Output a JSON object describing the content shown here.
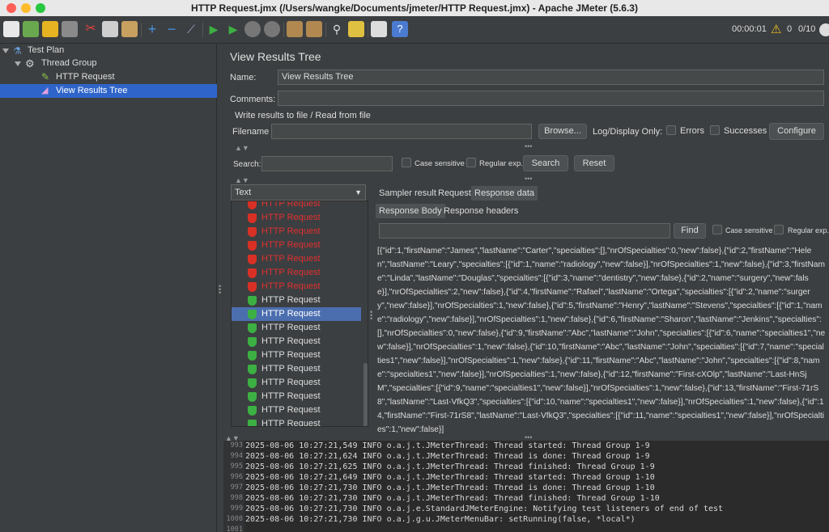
{
  "window": {
    "title": "HTTP Request.jmx (/Users/wangke/Documents/jmeter/HTTP Request.jmx) - Apache JMeter (5.6.3)"
  },
  "toolbar": {
    "timer": "00:00:01",
    "warning_count": "0",
    "thread_counter": "0/10",
    "icons": [
      "new-icon",
      "templates-icon",
      "open-icon",
      "save-icon",
      "cut-icon",
      "copy-icon",
      "paste-icon",
      "expand-icon",
      "collapse-icon",
      "toggle-icon",
      "start-icon",
      "start-no-pauses-icon",
      "stop-icon",
      "shutdown-icon",
      "clear-icon",
      "clear-all-icon",
      "search-icon",
      "reset-search-icon",
      "function-helper-icon",
      "help-icon"
    ]
  },
  "tree": {
    "items": [
      {
        "label": "Test Plan"
      },
      {
        "label": "Thread Group"
      },
      {
        "label": "HTTP Request"
      },
      {
        "label": "View Results Tree"
      }
    ]
  },
  "panel": {
    "title": "View Results Tree",
    "name_label": "Name:",
    "name_value": "View Results Tree",
    "comments_label": "Comments:",
    "comments_value": "",
    "file_section": "Write results to file / Read from file",
    "filename_label": "Filename",
    "filename_value": "",
    "browse_label": "Browse...",
    "logdisplay_label": "Log/Display Only:",
    "errors_label": "Errors",
    "successes_label": "Successes",
    "configure_label": "Configure"
  },
  "search": {
    "label": "Search:",
    "value": "",
    "case_sensitive": "Case sensitive",
    "regular_exp": "Regular exp.",
    "search_btn": "Search",
    "reset_btn": "Reset"
  },
  "results": {
    "renderer": "Text",
    "rows": [
      {
        "label": "HTTP Request",
        "status": "error"
      },
      {
        "label": "HTTP Request",
        "status": "error"
      },
      {
        "label": "HTTP Request",
        "status": "error"
      },
      {
        "label": "HTTP Request",
        "status": "error"
      },
      {
        "label": "HTTP Request",
        "status": "error"
      },
      {
        "label": "HTTP Request",
        "status": "error"
      },
      {
        "label": "HTTP Request",
        "status": "error"
      },
      {
        "label": "HTTP Request",
        "status": "success"
      },
      {
        "label": "HTTP Request",
        "status": "success",
        "selected": true
      },
      {
        "label": "HTTP Request",
        "status": "success"
      },
      {
        "label": "HTTP Request",
        "status": "success"
      },
      {
        "label": "HTTP Request",
        "status": "success"
      },
      {
        "label": "HTTP Request",
        "status": "success"
      },
      {
        "label": "HTTP Request",
        "status": "success"
      },
      {
        "label": "HTTP Request",
        "status": "success"
      },
      {
        "label": "HTTP Request",
        "status": "success"
      },
      {
        "label": "HTTP Request",
        "status": "success"
      }
    ]
  },
  "detail": {
    "tabs": [
      "Sampler result",
      "Request",
      "Response data"
    ],
    "subtabs": [
      "Response Body",
      "Response headers"
    ],
    "find_btn": "Find",
    "case_sensitive": "Case sensitive",
    "regular_exp": "Regular exp.",
    "body": "[{\"id\":1,\"firstName\":\"James\",\"lastName\":\"Carter\",\"specialties\":[],\"nrOfSpecialties\":0,\"new\":false},{\"id\":2,\"firstName\":\"Helen\",\"lastName\":\"Leary\",\"specialties\":[{\"id\":1,\"name\":\"radiology\",\"new\":false}],\"nrOfSpecialties\":1,\"new\":false},{\"id\":3,\"firstName\":\"Linda\",\"lastName\":\"Douglas\",\"specialties\":[{\"id\":3,\"name\":\"dentistry\",\"new\":false},{\"id\":2,\"name\":\"surgery\",\"new\":false}],\"nrOfSpecialties\":2,\"new\":false},{\"id\":4,\"firstName\":\"Rafael\",\"lastName\":\"Ortega\",\"specialties\":[{\"id\":2,\"name\":\"surgery\",\"new\":false}],\"nrOfSpecialties\":1,\"new\":false},{\"id\":5,\"firstName\":\"Henry\",\"lastName\":\"Stevens\",\"specialties\":[{\"id\":1,\"name\":\"radiology\",\"new\":false}],\"nrOfSpecialties\":1,\"new\":false},{\"id\":6,\"firstName\":\"Sharon\",\"lastName\":\"Jenkins\",\"specialties\":[],\"nrOfSpecialties\":0,\"new\":false},{\"id\":9,\"firstName\":\"Abc\",\"lastName\":\"John\",\"specialties\":[{\"id\":6,\"name\":\"specialties1\",\"new\":false}],\"nrOfSpecialties\":1,\"new\":false},{\"id\":10,\"firstName\":\"Abc\",\"lastName\":\"John\",\"specialties\":[{\"id\":7,\"name\":\"specialties1\",\"new\":false}],\"nrOfSpecialties\":1,\"new\":false},{\"id\":11,\"firstName\":\"Abc\",\"lastName\":\"John\",\"specialties\":[{\"id\":8,\"name\":\"specialties1\",\"new\":false}],\"nrOfSpecialties\":1,\"new\":false},{\"id\":12,\"firstName\":\"First-cXOlp\",\"lastName\":\"Last-HnSjM\",\"specialties\":[{\"id\":9,\"name\":\"specialties1\",\"new\":false}],\"nrOfSpecialties\":1,\"new\":false},{\"id\":13,\"firstName\":\"First-71rS8\",\"lastName\":\"Last-VfkQ3\",\"specialties\":[{\"id\":10,\"name\":\"specialties1\",\"new\":false}],\"nrOfSpecialties\":1,\"new\":false},{\"id\":14,\"firstName\":\"First-71rS8\",\"lastName\":\"Last-VfkQ3\",\"specialties\":[{\"id\":11,\"name\":\"specialties1\",\"new\":false}],\"nrOfSpecialties\":1,\"new\":false}]"
  },
  "log": {
    "lines": [
      {
        "num": "993",
        "text": "2025-08-06 10:27:21,549 INFO o.a.j.t.JMeterThread: Thread started: Thread Group 1-9"
      },
      {
        "num": "994",
        "text": "2025-08-06 10:27:21,624 INFO o.a.j.t.JMeterThread: Thread is done: Thread Group 1-9"
      },
      {
        "num": "995",
        "text": "2025-08-06 10:27:21,625 INFO o.a.j.t.JMeterThread: Thread finished: Thread Group 1-9"
      },
      {
        "num": "996",
        "text": "2025-08-06 10:27:21,649 INFO o.a.j.t.JMeterThread: Thread started: Thread Group 1-10"
      },
      {
        "num": "997",
        "text": "2025-08-06 10:27:21,730 INFO o.a.j.t.JMeterThread: Thread is done: Thread Group 1-10"
      },
      {
        "num": "998",
        "text": "2025-08-06 10:27:21,730 INFO o.a.j.t.JMeterThread: Thread finished: Thread Group 1-10"
      },
      {
        "num": "999",
        "text": "2025-08-06 10:27:21,730 INFO o.a.j.e.StandardJMeterEngine: Notifying test listeners of end of test"
      },
      {
        "num": "1000",
        "text": "2025-08-06 10:27:21,730 INFO o.a.j.g.u.JMeterMenuBar: setRunning(false, *local*)"
      },
      {
        "num": "1001",
        "text": ""
      }
    ]
  },
  "colors": {
    "error_text": "#e03030",
    "success_icon": "#3cb043",
    "error_icon": "#d93025",
    "selection": "#4b6eaf"
  }
}
